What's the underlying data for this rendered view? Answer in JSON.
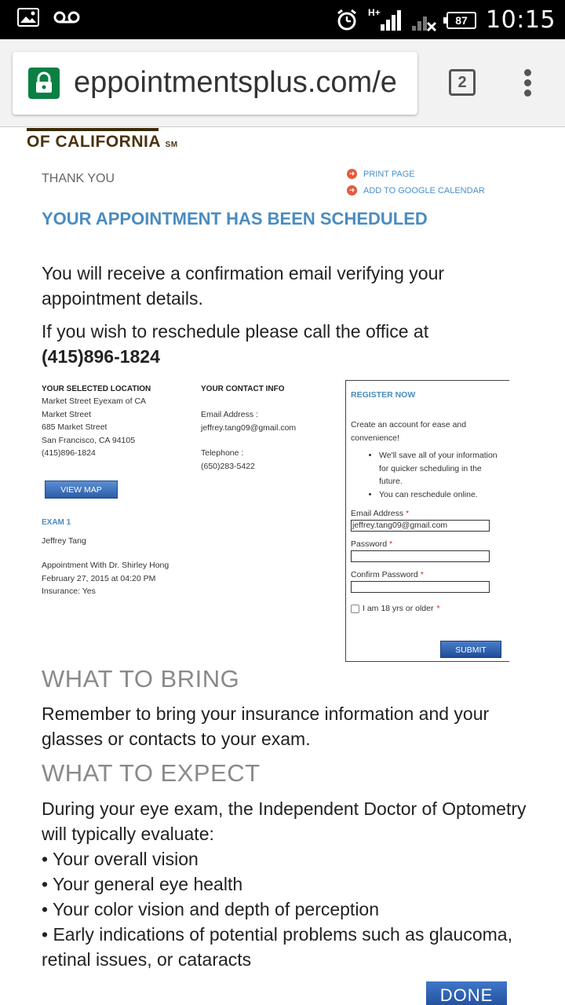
{
  "status_bar": {
    "time": "10:15",
    "battery": "87",
    "network": "H+"
  },
  "browser": {
    "url": "eppointmentsplus.com/e",
    "tab_count": "2"
  },
  "brand": {
    "logo_text": "OF CALIFORNIA",
    "logo_mark": "SM"
  },
  "header": {
    "thank_you": "THANK YOU",
    "print_page": "PRINT PAGE",
    "add_to_calendar": "ADD TO GOOGLE CALENDAR",
    "scheduled": "YOUR APPOINTMENT HAS BEEN SCHEDULED"
  },
  "confirmation": {
    "line1": "You will receive a confirmation email verifying your appointment details.",
    "line2": "If you wish to reschedule please call the office at",
    "phone": "(415)896-1824"
  },
  "location": {
    "title": "YOUR SELECTED LOCATION",
    "name": "Market Street Eyexam of CA",
    "sub": "Market Street",
    "address": "685 Market Street",
    "city": "San Francisco, CA 94105",
    "phone": "(415)896-1824",
    "view_map": "VIEW MAP"
  },
  "contact": {
    "title": "YOUR CONTACT INFO",
    "email_label": "Email Address :",
    "email": "jeffrey.tang09@gmail.com",
    "telephone_label": "Telephone :",
    "telephone": "(650)283-5422"
  },
  "exam": {
    "title": "EXAM 1",
    "patient": "Jeffrey Tang",
    "doctor": "Appointment With Dr. Shirley Hong",
    "datetime": "February 27, 2015 at 04:20 PM",
    "insurance": "Insurance: Yes"
  },
  "register": {
    "title": "REGISTER NOW",
    "intro": "Create an account for ease and convenience!",
    "bullets": [
      "We'll save all of your information for quicker scheduling in the future.",
      "You can reschedule online."
    ],
    "email_label": "Email Address",
    "email_value": "jeffrey.tang09@gmail.com",
    "password_label": "Password",
    "confirm_label": "Confirm Password",
    "age_label": "I am 18 yrs or older",
    "required_mark": "*",
    "submit": "SUBMIT"
  },
  "bring": {
    "heading": "WHAT TO BRING",
    "text": "Remember to bring your insurance information and your glasses or contacts to your exam."
  },
  "expect": {
    "heading": "WHAT TO EXPECT",
    "intro": "During your eye exam, the Independent Doctor of Optometry will typically evaluate:",
    "items": [
      "• Your overall vision",
      "• Your general eye health",
      "• Your color vision and depth of perception",
      "• Early indications of potential problems such as glaucoma, retinal issues, or cataracts"
    ]
  },
  "footer": {
    "done": "DONE"
  }
}
